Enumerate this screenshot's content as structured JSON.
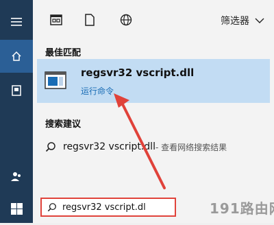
{
  "rail": {
    "items": [
      {
        "name": "menu-icon"
      },
      {
        "name": "home-icon"
      },
      {
        "name": "documents-icon"
      },
      {
        "name": "people-icon"
      },
      {
        "name": "windows-start-icon"
      }
    ]
  },
  "topbar": {
    "filter_label": "筛选器",
    "icons": [
      "apps-icon",
      "documents-icon",
      "web-icon",
      "chevron-down-icon"
    ]
  },
  "best_match": {
    "section_label": "最佳匹配",
    "title": "regsvr32 vscript.dll",
    "subtitle": "运行命令"
  },
  "suggestions": {
    "section_label": "搜索建议",
    "items": [
      {
        "query": "regsvr32 vscript.dll",
        "suffix": " - 查看网络搜索结果"
      }
    ]
  },
  "search": {
    "value": "regsvr32 vscript.dl"
  },
  "watermark": "191路由网",
  "colors": {
    "rail": "#1f3a56",
    "rail_active": "#2b5f96",
    "selected_bg": "#c2dcf3",
    "accent": "#1a6db5",
    "highlight_red": "#e0423a"
  }
}
